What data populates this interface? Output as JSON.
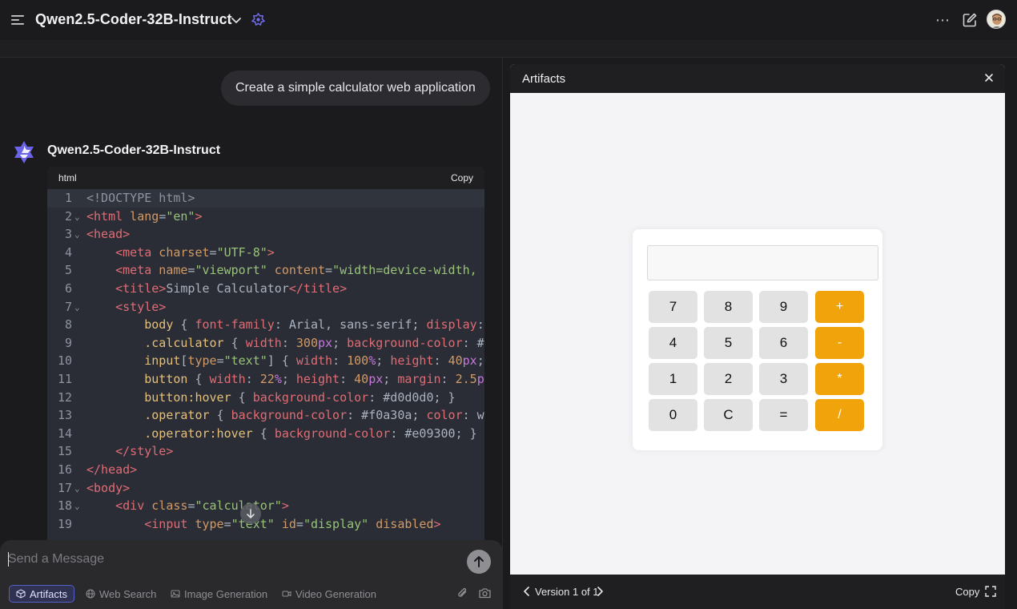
{
  "header": {
    "model_name": "Qwen2.5-Coder-32B-Instruct",
    "menu_icon": "hamburger-menu-icon",
    "more_icon": "ellipsis-icon",
    "edit_icon": "new-chat-edit-icon"
  },
  "chat": {
    "user_message": "Create a simple calculator web application",
    "assistant_name": "Qwen2.5-Coder-32B-Instruct",
    "code_block": {
      "language": "html",
      "copy_label": "Copy",
      "lines": [
        {
          "n": "1",
          "fold": false
        },
        {
          "n": "2",
          "fold": true
        },
        {
          "n": "3",
          "fold": true
        },
        {
          "n": "4",
          "fold": false
        },
        {
          "n": "5",
          "fold": false
        },
        {
          "n": "6",
          "fold": false
        },
        {
          "n": "7",
          "fold": true
        },
        {
          "n": "8",
          "fold": false
        },
        {
          "n": "9",
          "fold": false
        },
        {
          "n": "10",
          "fold": false
        },
        {
          "n": "11",
          "fold": false
        },
        {
          "n": "12",
          "fold": false
        },
        {
          "n": "13",
          "fold": false
        },
        {
          "n": "14",
          "fold": false
        },
        {
          "n": "15",
          "fold": false
        },
        {
          "n": "16",
          "fold": false
        },
        {
          "n": "17",
          "fold": true
        },
        {
          "n": "18",
          "fold": true
        },
        {
          "n": "19",
          "fold": false
        }
      ],
      "text": {
        "l1": "<!DOCTYPE html>",
        "l2_tag_open": "<html",
        "l2_attr": " lang",
        "l2_eq": "=",
        "l2_str": "\"en\"",
        "l2_close": ">",
        "l3": "<head>",
        "l4_tag": "<meta",
        "l4_attr": " charset",
        "l4_str": "\"UTF-8\"",
        "l5_tag": "<meta",
        "l5_attr1": " name",
        "l5_str1": "\"viewport\"",
        "l5_attr2": " content",
        "l5_str2": "\"width=device-width, ini",
        "l6_tag1": "<title>",
        "l6_text": "Simple Calculator",
        "l6_tag2": "</title>",
        "l7": "<style>",
        "l8_sel": "body",
        "l8_rest1": " { ",
        "l8_prop1": "font-family",
        "l8_rest2": ": Arial, sans-serif; ",
        "l8_prop2": "display",
        "l8_rest3": ": f",
        "l9_sel": ".calculator",
        "l9_rest1": " { ",
        "l9_prop1": "width",
        "l9_rest2": ": ",
        "l9_num": "300",
        "l9_unit": "px",
        "l9_rest3": "; ",
        "l9_prop2": "background-color",
        "l9_rest4": ": #ff",
        "l10_sel": "input",
        "l10_rest1": "[",
        "l10_attr": "type",
        "l10_rest2": "=",
        "l10_str": "\"text\"",
        "l10_rest3": "] { ",
        "l10_prop1": "width",
        "l10_rest4": ": ",
        "l10_num1": "100",
        "l10_unit1": "%",
        "l10_rest5": "; ",
        "l10_prop2": "height",
        "l10_rest6": ": ",
        "l10_num2": "40",
        "l10_unit2": "px",
        "l10_rest7": "; m",
        "l11_sel": "button",
        "l11_rest1": " { ",
        "l11_prop1": "width",
        "l11_rest2": ": ",
        "l11_num1": "22",
        "l11_unit1": "%",
        "l11_rest3": "; ",
        "l11_prop2": "height",
        "l11_rest4": ": ",
        "l11_num2": "40",
        "l11_unit2": "px",
        "l11_rest5": "; ",
        "l11_prop3": "margin",
        "l11_rest6": ": ",
        "l11_num3": "2.5",
        "l11_unit3": "px",
        "l12_sel": "button:hover",
        "l12_rest1": " { ",
        "l12_prop": "background-color",
        "l12_rest2": ": #d0d0d0; }",
        "l13_sel": ".operator",
        "l13_rest1": " { ",
        "l13_prop1": "background-color",
        "l13_rest2": ": #f0a30a; ",
        "l13_prop2": "color",
        "l13_rest3": ": wh",
        "l14_sel": ".operator:hover",
        "l14_rest1": " { ",
        "l14_prop": "background-color",
        "l14_rest2": ": #e09300; }",
        "l15": "</style>",
        "l16": "</head>",
        "l17": "<body>",
        "l18_tag": "<div",
        "l18_attr": " class",
        "l18_str": "\"calculator\"",
        "l18_close": ">",
        "l19_tag": "<input",
        "l19_attr1": " type",
        "l19_str1": "\"text\"",
        "l19_attr2": " id",
        "l19_str2": "\"display\"",
        "l19_attr3": " disabled",
        "l19_close": ">"
      }
    }
  },
  "composer": {
    "placeholder": "Send a Message",
    "tools": {
      "artifacts": "Artifacts",
      "web_search": "Web Search",
      "image_generation": "Image Generation",
      "video_generation": "Video Generation"
    }
  },
  "artifacts": {
    "title": "Artifacts",
    "version_label": "Version 1 of 1",
    "copy_label": "Copy",
    "calculator": {
      "display_value": "",
      "buttons": [
        "7",
        "8",
        "9",
        "+",
        "4",
        "5",
        "6",
        "-",
        "1",
        "2",
        "3",
        "*",
        "0",
        "C",
        "=",
        "/"
      ],
      "operator_color": "#f0a30a",
      "button_color": "#e2e2e2"
    }
  },
  "colors": {
    "background": "#1b1b1d",
    "accent": "#5560c8"
  }
}
